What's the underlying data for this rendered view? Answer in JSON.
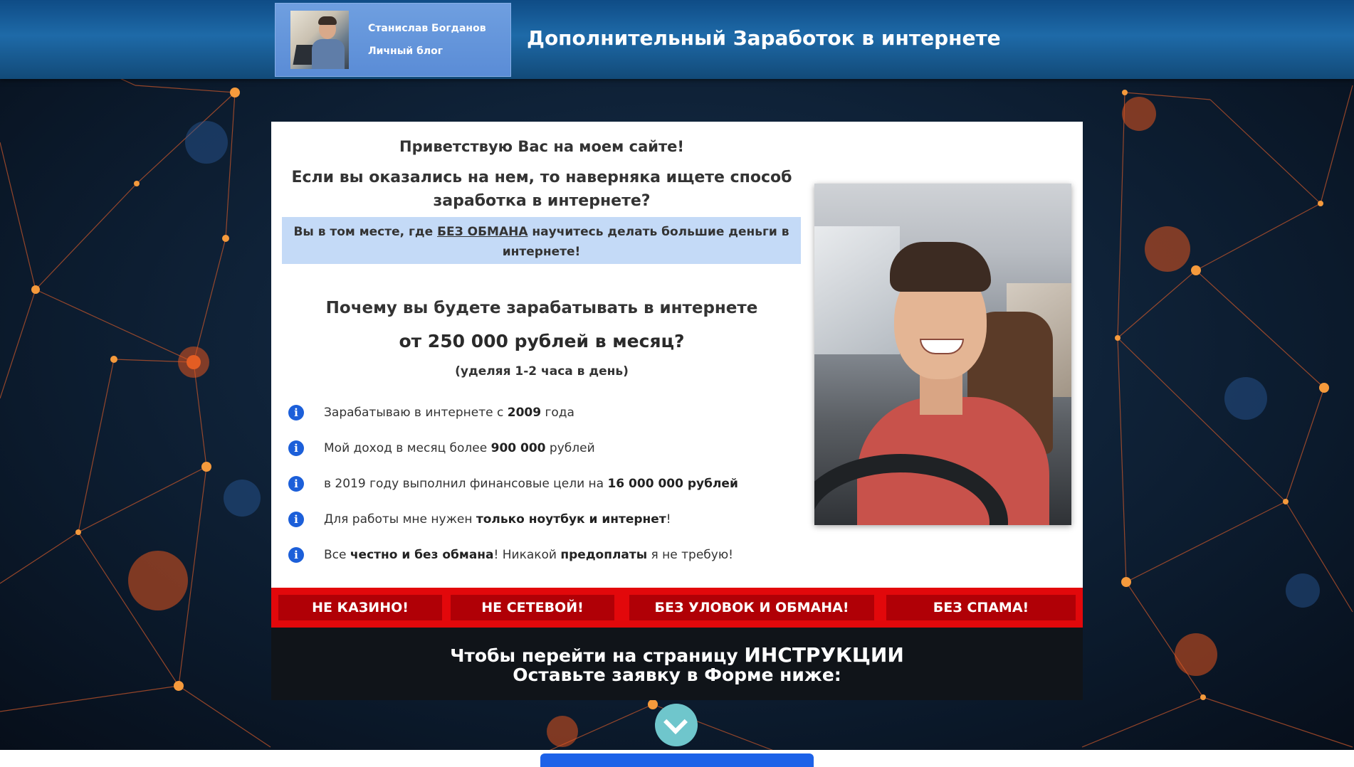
{
  "header": {
    "blog_name": "Станислав Богданов",
    "blog_sub": "Личный блог",
    "site_title": "Дополнительный Заработок в интернете"
  },
  "intro": {
    "greeting": "Приветствую Вас на моем сайте!",
    "question_line1": "Если вы оказались на нем, то наверняка ищете способ",
    "question_line2": "заработка в интернете?",
    "highlight_pre": "Вы в том месте, где ",
    "highlight_strong": "БЕЗ ОБМАНА",
    "highlight_post": " научитесь делать большие деньги в",
    "highlight_line2": "интернете!"
  },
  "why": {
    "line1": "Почему вы будете зарабатывать в интернете",
    "line2": "от 250 000 рублей в месяц?",
    "line3": "(уделяя 1-2 часа в день)"
  },
  "bullets": [
    {
      "pre": "Зарабатываю в интернете с ",
      "strong": "2009",
      "post": " года"
    },
    {
      "pre": "Мой доход в месяц более ",
      "strong": "900 000",
      "post": " рублей"
    },
    {
      "pre": "в 2019 году выполнил финансовые цели на ",
      "strong": "16 000 000 рублей",
      "post": ""
    },
    {
      "pre": "Для работы мне нужен ",
      "strong": "только ноутбук и интернет",
      "post": "!"
    },
    {
      "pre": "Все ",
      "strong": "честно и без обмана",
      "post": "! Никакой ",
      "strong2": "предоплаты",
      "post2": " я не требую!"
    }
  ],
  "badges": [
    "НЕ КАЗИНО!",
    "НЕ СЕТЕВОЙ!",
    "БЕЗ УЛОВОК И ОБМАНА!",
    "БЕЗ СПАМА!"
  ],
  "cta": {
    "line1_pre": "Чтобы перейти на страницу ",
    "line1_strong": "ИНСТРУКЦИИ",
    "line2": "Оставьте заявку в Форме ниже:"
  },
  "icons": {
    "info": "info-icon",
    "scroll": "chevron-down-icon"
  },
  "colors": {
    "header_blue": "#1e6aa8",
    "accent_red": "#e2080b",
    "badge_red": "#b00006",
    "highlight_blue": "#c4daf7",
    "info_blue": "#1c5fd9",
    "scroll_teal": "#6fc6cc"
  }
}
